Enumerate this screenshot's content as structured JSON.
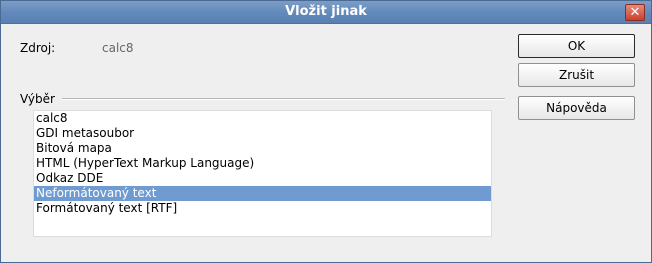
{
  "window": {
    "title": "Vložit jinak",
    "close_glyph": "✕"
  },
  "source": {
    "label": "Zdroj:",
    "value": "calc8"
  },
  "selection": {
    "label": "Výběr",
    "items": [
      {
        "label": "calc8",
        "selected": false
      },
      {
        "label": "GDI metasoubor",
        "selected": false
      },
      {
        "label": "Bitová mapa",
        "selected": false
      },
      {
        "label": "HTML (HyperText Markup Language)",
        "selected": false
      },
      {
        "label": "Odkaz DDE",
        "selected": false
      },
      {
        "label": "Neformátovaný text",
        "selected": true
      },
      {
        "label": "Formátovaný text [RTF]",
        "selected": false
      }
    ]
  },
  "buttons": {
    "ok": "OK",
    "cancel": "Zrušit",
    "help": "Nápověda"
  },
  "colors": {
    "title_bar": "#6289bb",
    "selection": "#6f9bd1",
    "close": "#c9412e"
  }
}
